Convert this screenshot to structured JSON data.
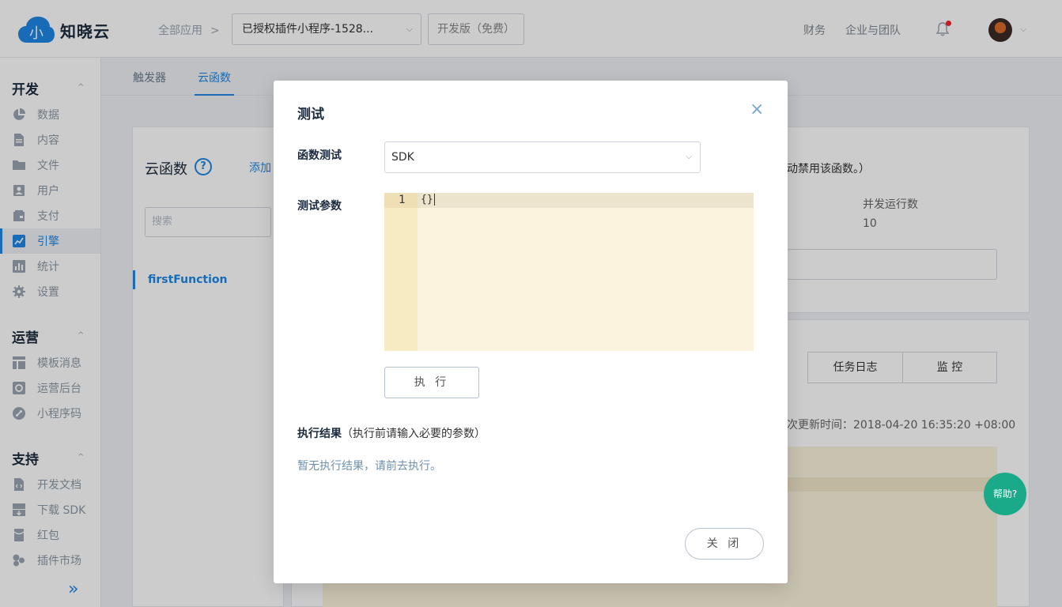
{
  "brand": {
    "name": "知晓云",
    "logo_glyph": "小",
    "color": "#1e88e5"
  },
  "header": {
    "breadcrumb": "全部应用",
    "breadcrumb_sep": ">",
    "app_select": "已授权插件小程序-1528...",
    "plan": "开发版（免费）",
    "links": [
      "财务",
      "企业与团队"
    ]
  },
  "sidebar": {
    "sections": [
      {
        "title": "开发",
        "items": [
          "数据",
          "内容",
          "文件",
          "用户",
          "支付",
          "引擎",
          "统计",
          "设置"
        ]
      },
      {
        "title": "运营",
        "items": [
          "模板消息",
          "运营后台",
          "小程序码"
        ]
      },
      {
        "title": "支持",
        "items": [
          "开发文档",
          "下载 SDK",
          "红包",
          "插件市场"
        ]
      }
    ],
    "active": "引擎",
    "expand": "»"
  },
  "tabs": [
    "触发器",
    "云函数"
  ],
  "active_tab": "云函数",
  "background": {
    "title": "云函数",
    "help": "?",
    "add": "添加",
    "search_placeholder": "搜索",
    "function_name": "firstFunction",
    "note_fragment": "动禁用该函数。）",
    "concurrency_label": "并发运行数",
    "concurrency_value": "10",
    "buttons": [
      "任务日志",
      "监 控"
    ],
    "updated": "次更新时间：2018-04-20 16:35:20 +08:00"
  },
  "help_fab": "帮助?",
  "modal": {
    "title": "测试",
    "close_icon": "×",
    "function_test_label": "函数测试",
    "function_test_value": "SDK",
    "params_label": "测试参数",
    "editor": {
      "line_number": "1",
      "code": "{}"
    },
    "run_button": "执 行",
    "result_title": "执行结果",
    "result_hint": "（执行前请输入必要的参数）",
    "result_empty": "暂无执行结果，请前去执行。",
    "close_button": "关 闭"
  }
}
